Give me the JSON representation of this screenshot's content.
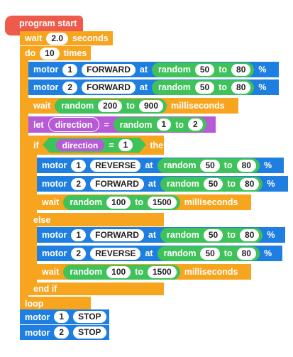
{
  "program": {
    "start_label": "program start",
    "wait_label": "wait",
    "wait_value": "2.0",
    "seconds_label": "seconds",
    "do_label": "do",
    "do_count": "10",
    "times_label": "times",
    "loop_label": "loop"
  },
  "blocks": {
    "motor_label": "motor",
    "at_label": "at",
    "percent": "%",
    "random_label": "random",
    "to_label": "to",
    "wait_label": "wait",
    "ms_label": "milliseconds",
    "let_label": "let",
    "eq_label": "=",
    "if_label": "if",
    "then_label": "then",
    "else_label": "else",
    "endif_label": "end if"
  },
  "m1": {
    "port": "1",
    "dir": "FORWARD",
    "min": "50",
    "max": "80"
  },
  "m2": {
    "port": "2",
    "dir": "FORWARD",
    "min": "50",
    "max": "80"
  },
  "w1": {
    "min": "200",
    "max": "900"
  },
  "let1": {
    "var": "direction",
    "min": "1",
    "max": "2"
  },
  "cond": {
    "var": "direction",
    "value": "1"
  },
  "t_m1": {
    "port": "1",
    "dir": "REVERSE",
    "min": "50",
    "max": "80"
  },
  "t_m2": {
    "port": "2",
    "dir": "FORWARD",
    "min": "50",
    "max": "80"
  },
  "t_w": {
    "min": "100",
    "max": "1500"
  },
  "e_m1": {
    "port": "1",
    "dir": "FORWARD",
    "min": "50",
    "max": "80"
  },
  "e_m2": {
    "port": "2",
    "dir": "REVERSE",
    "min": "50",
    "max": "80"
  },
  "e_w": {
    "min": "100",
    "max": "1500"
  },
  "stop1": {
    "port": "1",
    "dir": "STOP"
  },
  "stop2": {
    "port": "2",
    "dir": "STOP"
  },
  "colors": {
    "control": "#f7a51e",
    "motor": "#1f7fe0",
    "variable": "#b65ad6",
    "operator": "#3fc25a",
    "hat": "#ef5b4a"
  }
}
